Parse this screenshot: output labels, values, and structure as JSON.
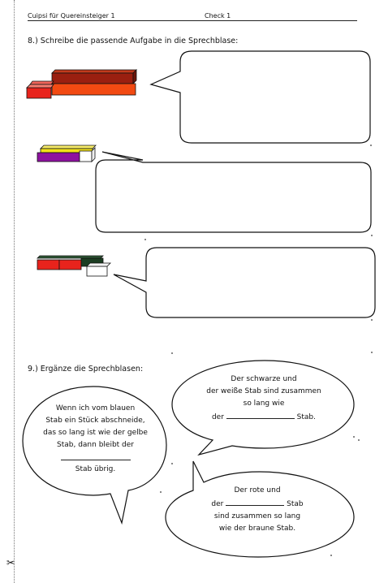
{
  "header": {
    "left": "Cuipsi für Quereinsteiger 1",
    "right": "Check 1"
  },
  "task8": {
    "instruction": "8.) Schreibe die passende Aufgabe in die Sprechblase:"
  },
  "task9": {
    "instruction": "9.) Ergänze die Sprechblasen:",
    "bubble_left": {
      "line1": "Wenn ich vom blauen",
      "line2": "Stab ein Stück abschneide,",
      "line3": "das so lang ist wie der gelbe",
      "line4": "Stab, dann bleibt der",
      "line6": "Stab übrig."
    },
    "bubble_top_right": {
      "line1": "Der schwarze und",
      "line2": "der weiße Stab sind zusammen",
      "line3": "so lang wie",
      "line4_pre": "der",
      "line4_post": "Stab."
    },
    "bubble_bottom_right": {
      "line1": "Der rote und",
      "line2_pre": "der",
      "line2_post": "Stab",
      "line3": "sind zusammen so lang",
      "line4": "wie der braune Stab."
    }
  },
  "colors": {
    "red": "#e8231c",
    "orange": "#f24a12",
    "brown": "#9a1f10",
    "purple": "#8e12a0",
    "yellow": "#f2e21a",
    "white": "#ffffff",
    "black_green": "#1c3d22",
    "outline": "#111111"
  },
  "icons": {
    "scissors": "✂"
  }
}
